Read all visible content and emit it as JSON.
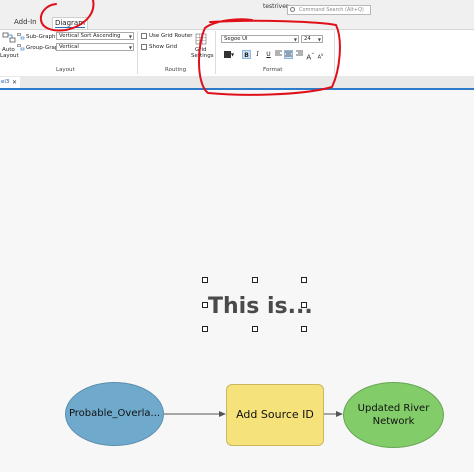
{
  "header": {
    "user": "testriver",
    "search_placeholder": "Command Search (Alt+Q)"
  },
  "tabs": [
    {
      "label": "Add-In"
    },
    {
      "label": "Diagram",
      "active": true
    }
  ],
  "ribbon": {
    "auto_layout_label_1": "Auto",
    "auto_layout_label_2": "Layout",
    "subgraph_label": "Sub-Graph",
    "subgraph_value": "Vertical Sort Ascending",
    "groupgraph_label": "Group-Graph",
    "groupgraph_value": "Vertical",
    "layout_group": "Layout",
    "grid_router_label": "Use Grid Router",
    "show_grid_label": "Show Grid",
    "grid_settings_1": "Grid",
    "grid_settings_2": "Settings",
    "routing_group": "Routing",
    "font_name": "Segoe UI",
    "font_size": "24",
    "format_group": "Format",
    "bold_label": "B",
    "italic_label": "I",
    "underline_label": "U",
    "grow_font_label": "A",
    "shrink_font_label": "A"
  },
  "document": {
    "tab_label": "el3",
    "close_label": "✕"
  },
  "canvas": {
    "text_element": "This is...",
    "nodes": {
      "input": "Probable_Overla...",
      "tool": "Add Source ID",
      "output": "Updated River Network"
    }
  },
  "colors": {
    "annotation": "#e0101b",
    "input_node": "#6fa9cc",
    "tool_node": "#f5e27a",
    "output_node": "#82cc6a",
    "accent": "#2e7bc9"
  }
}
